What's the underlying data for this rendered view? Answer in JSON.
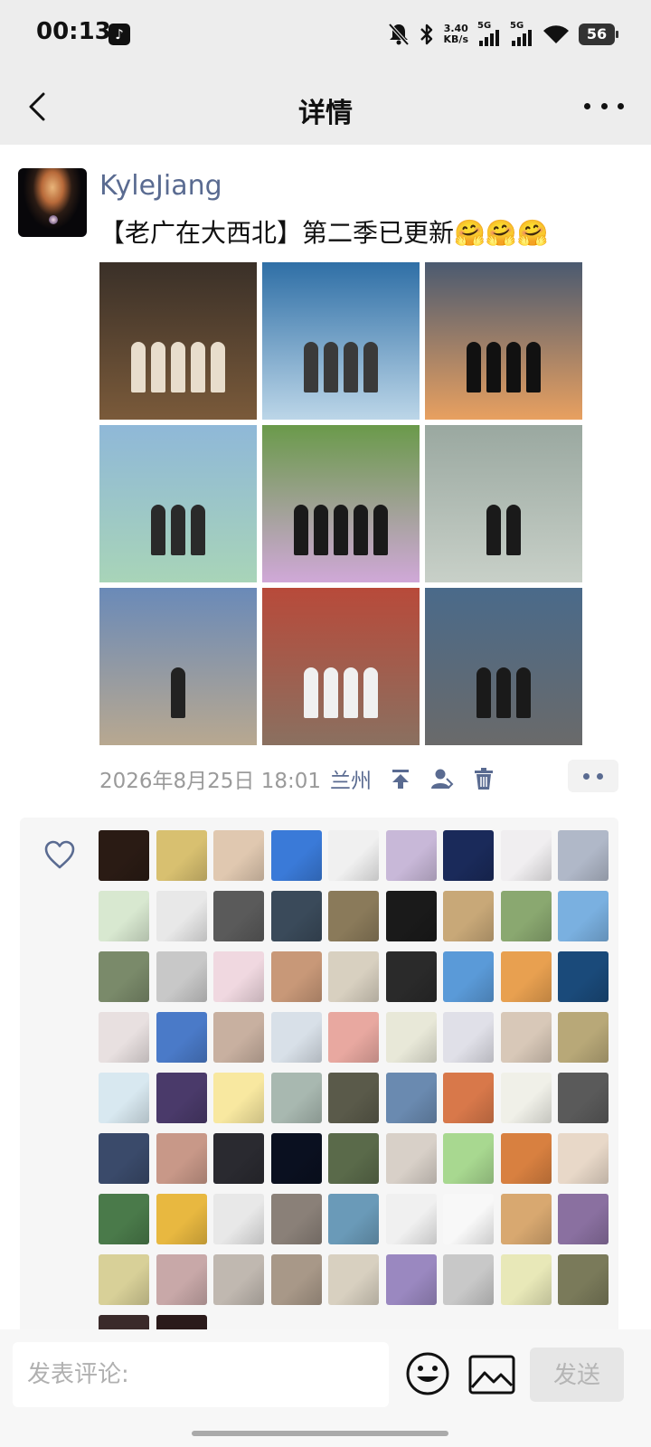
{
  "status_bar": {
    "time": "00:13",
    "net_speed_value": "3.40",
    "net_speed_unit": "KB/s",
    "signal1": "5G",
    "signal2": "5G",
    "battery": "56"
  },
  "nav": {
    "title": "详情"
  },
  "post": {
    "username": "KyleJiang",
    "text": "【老广在大西北】第二季已更新🤗🤗🤗",
    "date": "2026年8月25日 18:01",
    "location": "兰州",
    "photos": [
      {
        "top": "#3a3028",
        "bottom": "#7a5a3a",
        "figs": 5,
        "fig": "#e8ddcc"
      },
      {
        "top": "#2f6fa6",
        "bottom": "#bcd6e8",
        "figs": 4,
        "fig": "#3a3a3a"
      },
      {
        "top": "#4b5a70",
        "bottom": "#e8a060",
        "figs": 4,
        "fig": "#111111"
      },
      {
        "top": "#8fb8d8",
        "bottom": "#a8d4b8",
        "figs": 3,
        "fig": "#2a2a2a"
      },
      {
        "top": "#6a9a4a",
        "bottom": "#d0a8d8",
        "figs": 5,
        "fig": "#1a1a1a"
      },
      {
        "top": "#9aa8a0",
        "bottom": "#c8d0c8",
        "figs": 2,
        "fig": "#1a1a1a"
      },
      {
        "top": "#6a8ab8",
        "bottom": "#b8a890",
        "figs": 1,
        "fig": "#222222"
      },
      {
        "top": "#b84a3a",
        "bottom": "#8a7060",
        "figs": 4,
        "fig": "#f0f0f0"
      },
      {
        "top": "#4a6a8a",
        "bottom": "#6a6a6a",
        "figs": 3,
        "fig": "#1a1a1a"
      }
    ]
  },
  "likers": [
    "#2a1b14",
    "#d8c070",
    "#e0c8b0",
    "#3a7ad8",
    "#f0f0f0",
    "#c8b8d8",
    "#1a2a5a",
    "#f0eef0",
    "#b0b8c8",
    "#d8e8d0",
    "#e8e8e8",
    "#5a5a5a",
    "#3a4a5a",
    "#8a7a5a",
    "#1a1a1a",
    "#c8a878",
    "#8aa870",
    "#7ab0e0",
    "#7a8a6a",
    "#c8c8c8",
    "#f0d8e0",
    "#c89878",
    "#d8d0c0",
    "#2a2a2a",
    "#5a9ad8",
    "#e8a050",
    "#1a4a7a",
    "#e8e0e0",
    "#4a7ac8",
    "#c8b0a0",
    "#d8e0e8",
    "#e8a8a0",
    "#e8e8d8",
    "#e0e0e8",
    "#d8c8b8",
    "#b8a878",
    "#d8e8f0",
    "#4a3a6a",
    "#f8e8a0",
    "#a8b8b0",
    "#5a5a4a",
    "#6a8ab0",
    "#d8784a",
    "#f0f0e8",
    "#5a5a5a",
    "#3a4a6a",
    "#c89888",
    "#2a2a30",
    "#0a1020",
    "#5a6a4a",
    "#d8d0c8",
    "#a8d890",
    "#d88040",
    "#e8d8c8",
    "#4a7a4a",
    "#e8b840",
    "#e8e8e8",
    "#8a8078",
    "#6a9ab8",
    "#f0f0f0",
    "#f8f8f8",
    "#d8a870",
    "#8a70a0",
    "#d8d098",
    "#c8a8a8",
    "#c0b8b0",
    "#a89888",
    "#d8d0c0",
    "#9a88c0",
    "#c8c8c8",
    "#e8e8b8",
    "#7a7a5a",
    "#3a2a2a",
    "#2a1a1a"
  ],
  "comment": {
    "placeholder": "发表评论:",
    "send_label": "发送"
  }
}
